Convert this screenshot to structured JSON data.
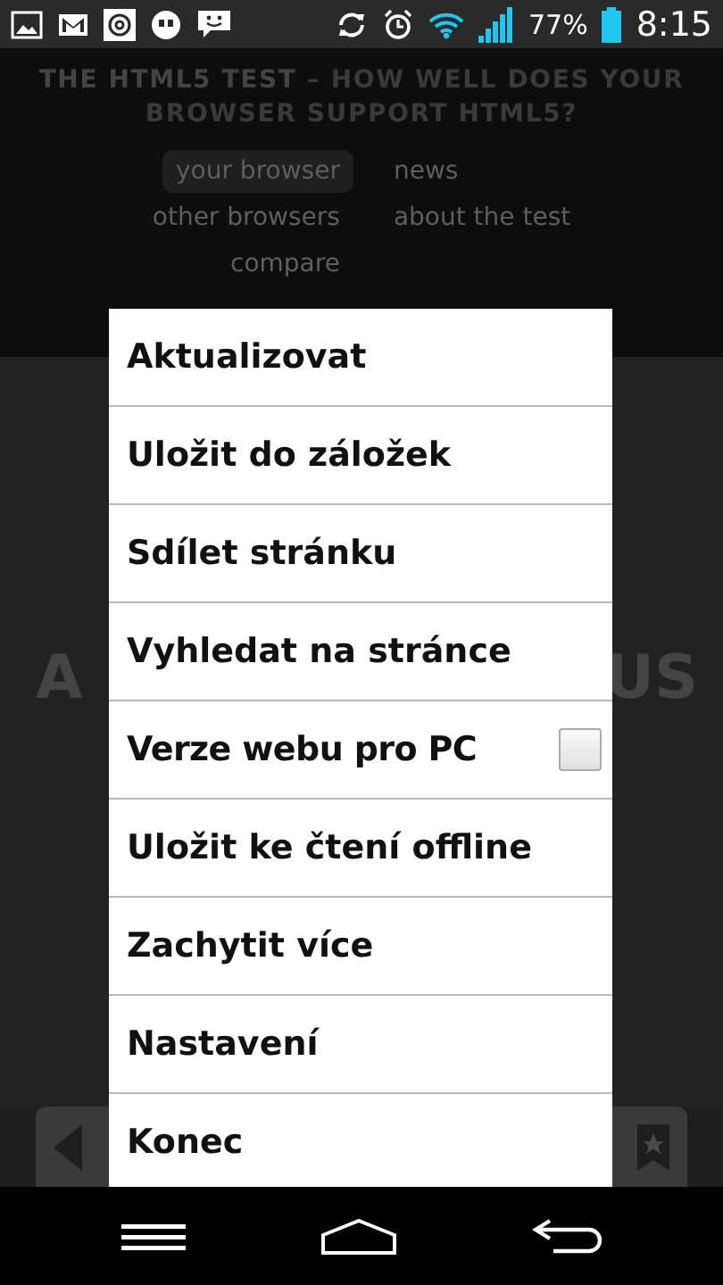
{
  "status_bar": {
    "battery_text": "77%",
    "time": "8:15"
  },
  "page": {
    "title_strong": "THE HTML5 TEST",
    "title_rest": " – HOW WELL DOES YOUR BROWSER SUPPORT HTML5?",
    "nav": [
      {
        "label": "your browser",
        "selected": true
      },
      {
        "label": "news",
        "selected": false
      },
      {
        "label": "other browsers",
        "selected": false
      },
      {
        "label": "about the test",
        "selected": false
      },
      {
        "label": "compare",
        "selected": false
      }
    ],
    "big_text_left": "A",
    "big_text_right": "US"
  },
  "menu": {
    "items": [
      {
        "kind": "plain",
        "label": "Aktualizovat"
      },
      {
        "kind": "plain",
        "label": "Uložit do záložek"
      },
      {
        "kind": "plain",
        "label": "Sdílet stránku"
      },
      {
        "kind": "plain",
        "label": "Vyhledat na stránce"
      },
      {
        "kind": "check",
        "label": "Verze webu pro PC",
        "checked": false
      },
      {
        "kind": "plain",
        "label": "Uložit ke čtení offline"
      },
      {
        "kind": "plain",
        "label": "Zachytit více"
      },
      {
        "kind": "plain",
        "label": "Nastavení"
      },
      {
        "kind": "plain",
        "label": "Konec"
      }
    ]
  }
}
